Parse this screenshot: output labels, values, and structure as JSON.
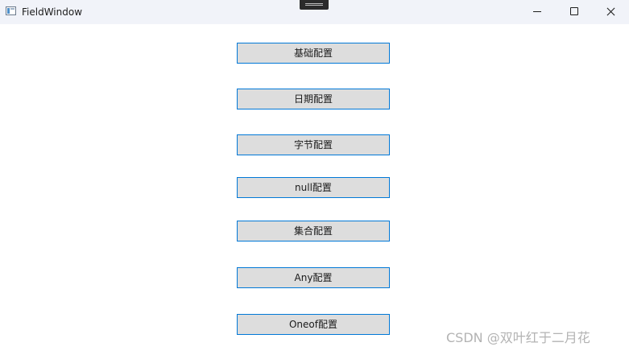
{
  "window": {
    "title": "FieldWindow"
  },
  "buttons": [
    {
      "label": "基础配置"
    },
    {
      "label": "日期配置"
    },
    {
      "label": "字节配置"
    },
    {
      "label": "null配置"
    },
    {
      "label": "集合配置"
    },
    {
      "label": "Any配置"
    },
    {
      "label": "Oneof配置"
    }
  ],
  "watermark": "CSDN @双叶红于二月花",
  "colors": {
    "button_border": "#0078d7",
    "button_background": "#dddddd",
    "titlebar_background": "#f1f3f9"
  },
  "icons": {
    "app": "app-window-icon",
    "minimize": "minimize-icon",
    "maximize": "maximize-icon",
    "close": "close-icon"
  }
}
